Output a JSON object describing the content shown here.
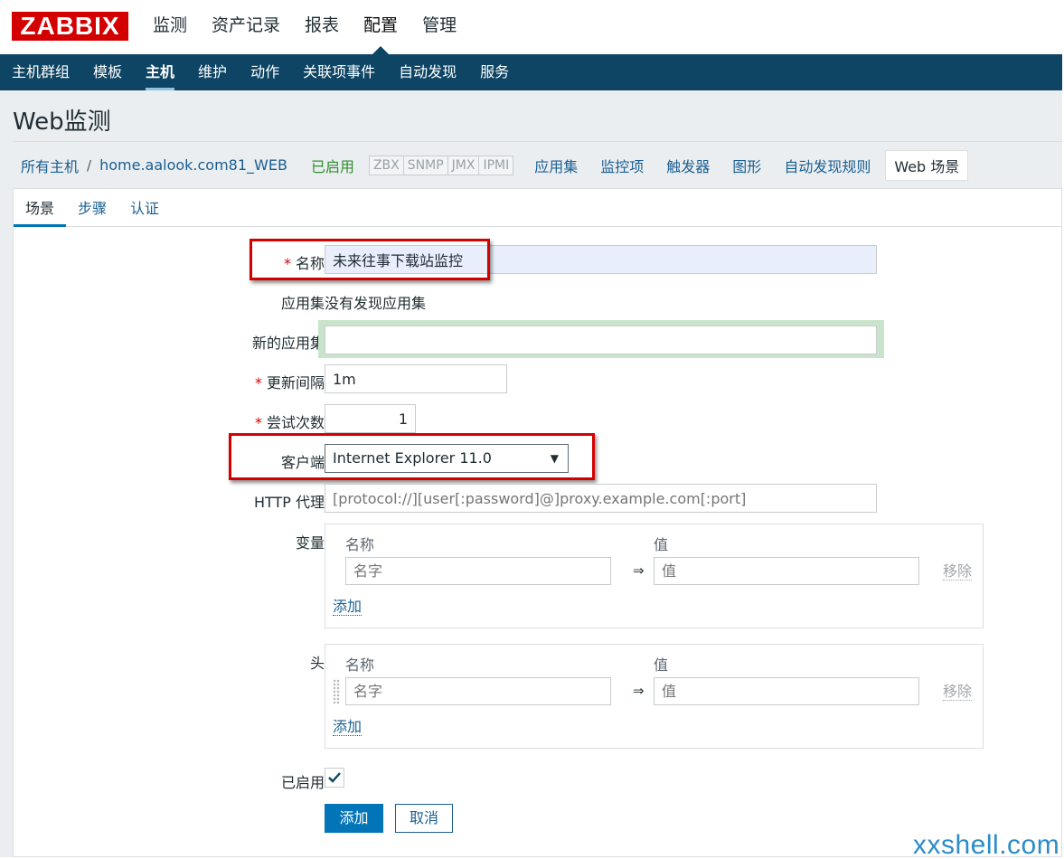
{
  "brand": {
    "logo": "ZABBIX",
    "color": "#d40000"
  },
  "main_nav": [
    "监测",
    "资产记录",
    "报表",
    "配置",
    "管理"
  ],
  "main_nav_active": "配置",
  "sub_nav": [
    "主机群组",
    "模板",
    "主机",
    "维护",
    "动作",
    "关联项事件",
    "自动发现",
    "服务"
  ],
  "sub_nav_active": "主机",
  "page_title": "Web监测",
  "breadcrumb": {
    "all_hosts": "所有主机",
    "separator": "/",
    "host": "home.aalook.com81_WEB"
  },
  "host_status": "已启用",
  "availability": [
    "ZBX",
    "SNMP",
    "JMX",
    "IPMI"
  ],
  "host_links": [
    "应用集",
    "监控项",
    "触发器",
    "图形",
    "自动发现规则",
    "Web 场景"
  ],
  "host_links_active": "Web 场景",
  "form_tabs": [
    "场景",
    "步骤",
    "认证"
  ],
  "form_tabs_active": "场景",
  "form": {
    "name_label": "名称",
    "name_value": "未来往事下载站监控",
    "app_label": "应用集",
    "app_value": "没有发现应用集",
    "new_app_label": "新的应用集",
    "new_app_value": "",
    "interval_label": "更新间隔",
    "interval_value": "1m",
    "attempts_label": "尝试次数",
    "attempts_value": "1",
    "agent_label": "客户端",
    "agent_value": "Internet Explorer 11.0",
    "proxy_label": "HTTP 代理",
    "proxy_placeholder": "[protocol://][user[:password]@]proxy.example.com[:port]",
    "variables_label": "变量",
    "headers_label": "头",
    "col_name": "名称",
    "col_value": "值",
    "name_placeholder": "名字",
    "value_placeholder": "值",
    "arrow": "⇒",
    "remove_label": "移除",
    "add_label": "添加",
    "enabled_label": "已启用",
    "enabled_checked": true,
    "submit_label": "添加",
    "cancel_label": "取消",
    "required_mark": "*"
  },
  "watermark": "xxshell.com",
  "colors": {
    "nav_bg": "#0e4564",
    "primary": "#0275b8",
    "link": "#1a5f92",
    "highlight": "#d40000"
  }
}
